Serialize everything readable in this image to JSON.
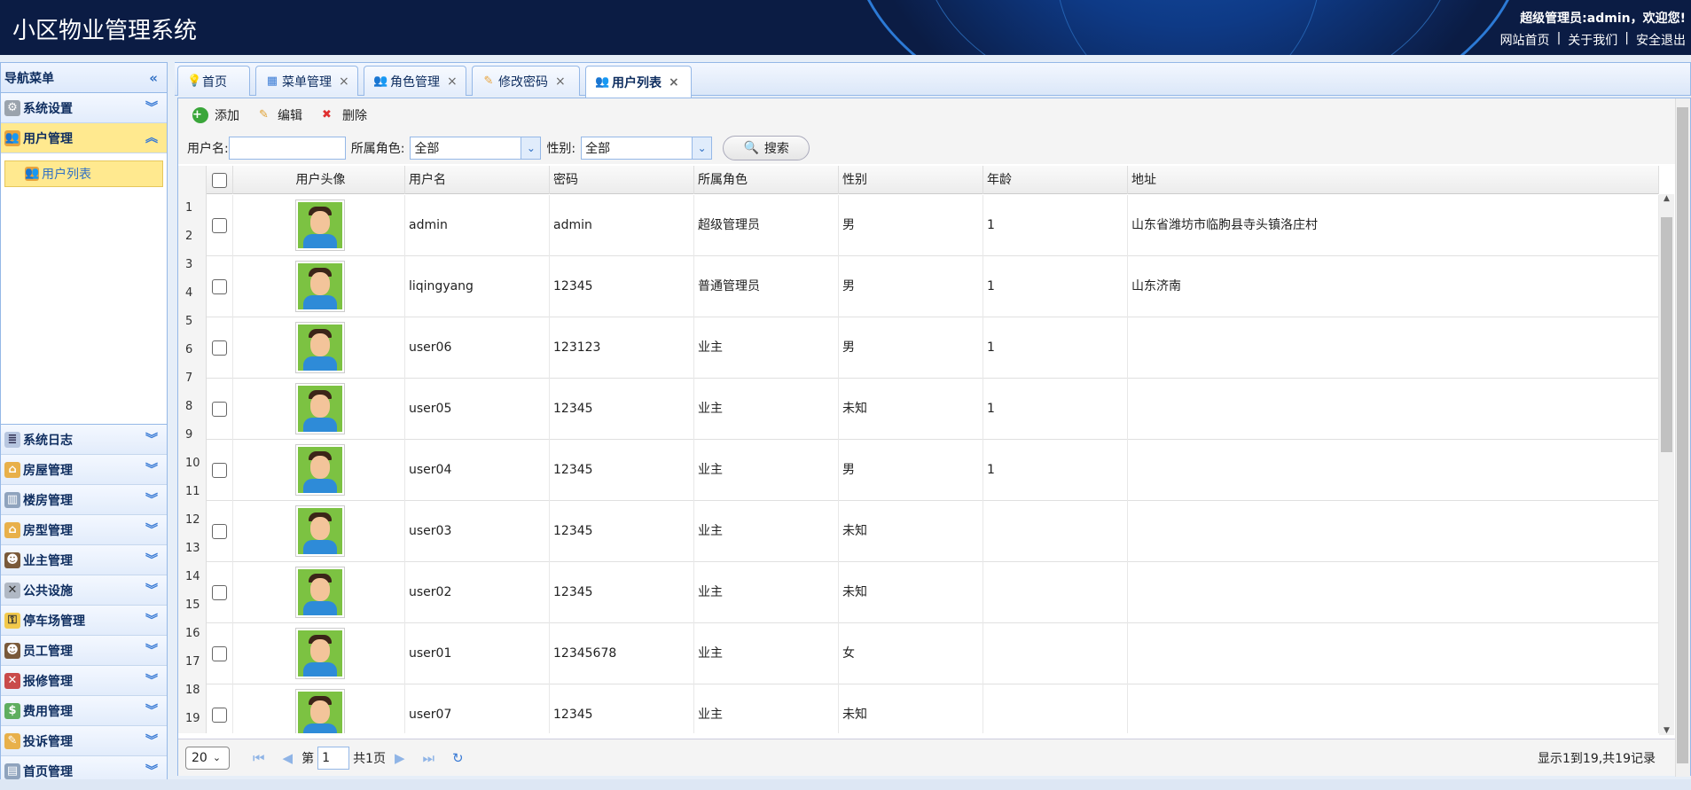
{
  "header": {
    "title": "小区物业管理系统",
    "welcome": "超级管理员:admin，欢迎您!",
    "links": [
      "网站首页",
      "|",
      "关于我们",
      "|",
      "安全退出"
    ]
  },
  "nav": {
    "title": "导航菜单",
    "sections_top": [
      {
        "label": "系统设置",
        "icon": "gear-icon",
        "active": false
      },
      {
        "label": "用户管理",
        "icon": "users-icon",
        "active": true
      }
    ],
    "active_sub": "用户列表",
    "sections_bottom": [
      {
        "label": "系统日志",
        "icon": "log-icon"
      },
      {
        "label": "房屋管理",
        "icon": "house-icon"
      },
      {
        "label": "楼房管理",
        "icon": "building-icon"
      },
      {
        "label": "房型管理",
        "icon": "layout-icon"
      },
      {
        "label": "业主管理",
        "icon": "owner-icon"
      },
      {
        "label": "公共设施",
        "icon": "tools-icon"
      },
      {
        "label": "停车场管理",
        "icon": "parking-icon"
      },
      {
        "label": "员工管理",
        "icon": "staff-icon"
      },
      {
        "label": "报修管理",
        "icon": "repair-icon"
      },
      {
        "label": "费用管理",
        "icon": "money-icon"
      },
      {
        "label": "投诉管理",
        "icon": "complaint-icon"
      },
      {
        "label": "首页管理",
        "icon": "homepage-icon"
      }
    ]
  },
  "tabs": [
    {
      "label": "首页",
      "closable": false,
      "active": false
    },
    {
      "label": "菜单管理",
      "closable": true,
      "active": false
    },
    {
      "label": "角色管理",
      "closable": true,
      "active": false
    },
    {
      "label": "修改密码",
      "closable": true,
      "active": false
    },
    {
      "label": "用户列表",
      "closable": true,
      "active": true
    }
  ],
  "toolbar": {
    "add": "添加",
    "edit": "编辑",
    "delete": "删除"
  },
  "search": {
    "username_label": "用户名:",
    "role_label": "所属角色:",
    "role_value": "全部",
    "gender_label": "性别:",
    "gender_value": "全部",
    "button": "搜索"
  },
  "table": {
    "columns": [
      "用户头像",
      "用户名",
      "密码",
      "所属角色",
      "性别",
      "年龄",
      "地址"
    ],
    "row_numbers": [
      "1",
      "2",
      "3",
      "4",
      "5",
      "6",
      "7",
      "8",
      "9",
      "10",
      "11",
      "12",
      "13",
      "14",
      "15",
      "16",
      "17",
      "18",
      "19"
    ],
    "rows": [
      {
        "username": "admin",
        "password": "admin",
        "role": "超级管理员",
        "gender": "男",
        "age": "1",
        "address": "山东省潍坊市临朐县寺头镇洛庄村"
      },
      {
        "username": "liqingyang",
        "password": "12345",
        "role": "普通管理员",
        "gender": "男",
        "age": "1",
        "address": "山东济南"
      },
      {
        "username": "user06",
        "password": "123123",
        "role": "业主",
        "gender": "男",
        "age": "1",
        "address": ""
      },
      {
        "username": "user05",
        "password": "12345",
        "role": "业主",
        "gender": "未知",
        "age": "1",
        "address": ""
      },
      {
        "username": "user04",
        "password": "12345",
        "role": "业主",
        "gender": "男",
        "age": "1",
        "address": ""
      },
      {
        "username": "user03",
        "password": "12345",
        "role": "业主",
        "gender": "未知",
        "age": "",
        "address": ""
      },
      {
        "username": "user02",
        "password": "12345",
        "role": "业主",
        "gender": "未知",
        "age": "",
        "address": ""
      },
      {
        "username": "user01",
        "password": "12345678",
        "role": "业主",
        "gender": "女",
        "age": "",
        "address": ""
      },
      {
        "username": "user07",
        "password": "12345",
        "role": "业主",
        "gender": "未知",
        "age": "",
        "address": ""
      }
    ]
  },
  "pager": {
    "page_size": "20",
    "page_prefix": "第",
    "page_value": "1",
    "page_total": "共1页",
    "info": "显示1到19,共19记录"
  }
}
